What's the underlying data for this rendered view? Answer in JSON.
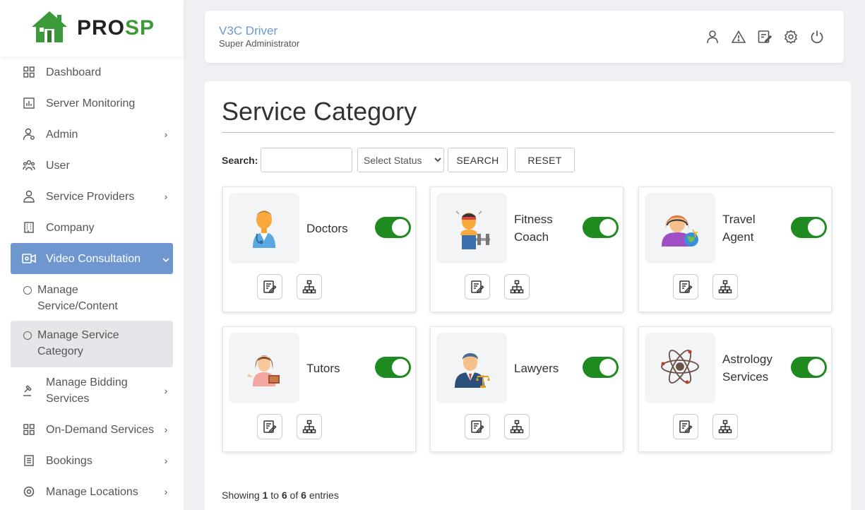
{
  "brand": {
    "part1": "PRO",
    "part2": "SP"
  },
  "header": {
    "user_name": "V3C Driver",
    "user_role": "Super Administrator"
  },
  "sidebar": {
    "items": [
      {
        "label": "Dashboard",
        "icon": "grid-icon"
      },
      {
        "label": "Server Monitoring",
        "icon": "chart-icon"
      },
      {
        "label": "Admin",
        "icon": "admin-icon",
        "has_children": true
      },
      {
        "label": "User",
        "icon": "users-icon"
      },
      {
        "label": "Service Providers",
        "icon": "provider-icon",
        "has_children": true
      },
      {
        "label": "Company",
        "icon": "building-icon"
      },
      {
        "label": "Video Consultation",
        "icon": "video-icon",
        "expanded": true,
        "active": true
      },
      {
        "label": "Manage Bidding Services",
        "icon": "gavel-icon",
        "has_children": true
      },
      {
        "label": "On-Demand Services",
        "icon": "grid-icon",
        "has_children": true
      },
      {
        "label": "Bookings",
        "icon": "list-icon",
        "has_children": true
      },
      {
        "label": "Manage Locations",
        "icon": "target-icon",
        "has_children": true
      }
    ],
    "subitems": [
      {
        "label": "Manage Service/Content"
      },
      {
        "label": "Manage Service Category",
        "selected": true
      }
    ]
  },
  "main": {
    "title": "Service Category",
    "search_label": "Search:",
    "search_value": "",
    "status_selected": "Select Status",
    "search_button": "SEARCH",
    "reset_button": "RESET",
    "categories": [
      {
        "name": "Doctors",
        "icon": "doctor-icon",
        "status_on": true
      },
      {
        "name": "Fitness Coach",
        "icon": "fitness-coach-icon",
        "status_on": true
      },
      {
        "name": "Travel Agent",
        "icon": "travel-agent-icon",
        "status_on": true
      },
      {
        "name": "Tutors",
        "icon": "tutor-icon",
        "status_on": true
      },
      {
        "name": "Lawyers",
        "icon": "lawyer-icon",
        "status_on": true
      },
      {
        "name": "Astrology Services",
        "icon": "atom-icon",
        "status_on": true
      }
    ],
    "footer": {
      "prefix": "Showing",
      "from": "1",
      "to_word": "to",
      "to": "6",
      "of_word": "of",
      "total": "6",
      "suffix": "entries"
    }
  },
  "colors": {
    "accent": "#6e97cf",
    "toggle_on": "#1f8a1f",
    "brand_green": "#3c9a3a"
  }
}
